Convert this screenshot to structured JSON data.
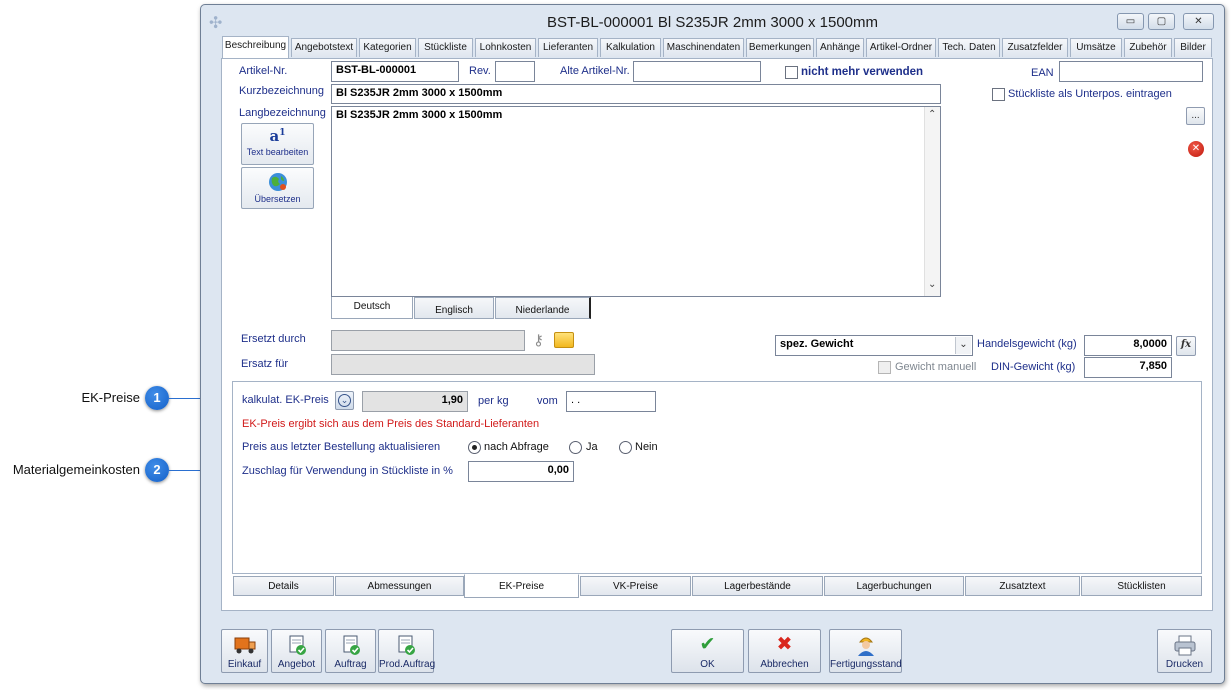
{
  "annotations": [
    {
      "label": "EK-Preise",
      "badge": "1"
    },
    {
      "label": "Materialgemeinkosten",
      "badge": "2"
    }
  ],
  "window": {
    "title": "BST-BL-000001 Bl S235JR 2mm 3000 x 1500mm",
    "controls": {
      "minimize": "▭",
      "maximize": "▢",
      "close": "✕"
    }
  },
  "tabs": [
    "Beschreibung",
    "Angebotstext",
    "Kategorien",
    "Stückliste",
    "Lohnkosten",
    "Lieferanten",
    "Kalkulation",
    "Maschinendaten",
    "Bemerkungen",
    "Anhänge",
    "Artikel-Ordner",
    "Tech. Daten",
    "Zusatzfelder",
    "Umsätze",
    "Zubehör",
    "Bilder"
  ],
  "form": {
    "artikel_nr_label": "Artikel-Nr.",
    "artikel_nr_value": "BST-BL-000001",
    "rev_label": "Rev.",
    "rev_value": "",
    "alte_artikel_label": "Alte Artikel-Nr.",
    "alte_artikel_value": "",
    "nicht_mehr_label": "nicht mehr verwenden",
    "ean_label": "EAN",
    "ean_value": "",
    "kurz_label": "Kurzbezeichnung",
    "kurz_value": "Bl S235JR 2mm 3000 x 1500mm",
    "stueckliste_label": "Stückliste als Unterpos. eintragen",
    "lang_label": "Langbezeichnung",
    "lang_value": "Bl S235JR 2mm 3000 x 1500mm",
    "text_bearbeiten": "Text bearbeiten",
    "uebersetzen": "Übersetzen",
    "dots_button": "...",
    "lang_tabs": [
      "Deutsch",
      "Englisch",
      "Niederlande"
    ],
    "ersetzt_label": "Ersetzt durch",
    "ersatz_label": "Ersatz für",
    "spez_gewicht": "spez. Gewicht",
    "gewicht_manuell": "Gewicht manuell",
    "handelsgewicht_label": "Handelsgewicht (kg)",
    "handelsgewicht_value": "8,0000",
    "fx": "fx",
    "din_label": "DIN-Gewicht (kg)",
    "din_value": "7,850"
  },
  "ek": {
    "kalk_label": "kalkulat. EK-Preis",
    "kalk_value": "1,90",
    "per_label": "per kg",
    "vom_label": "vom",
    "vom_value": ". .",
    "hint": "EK-Preis ergibt sich aus dem Preis des Standard-Lieferanten",
    "preis_label": "Preis aus letzter Bestellung aktualisieren",
    "radio_options": [
      "nach Abfrage",
      "Ja",
      "Nein"
    ],
    "zuschlag_label": "Zuschlag für Verwendung in Stückliste in %",
    "zuschlag_value": "0,00"
  },
  "subtabs": [
    "Details",
    "Abmessungen",
    "EK-Preise",
    "VK-Preise",
    "Lagerbestände",
    "Lagerbuchungen",
    "Zusatztext",
    "Stücklisten"
  ],
  "footer": {
    "einkauf": "Einkauf",
    "angebot": "Angebot",
    "auftrag": "Auftrag",
    "prodauftrag": "Prod.Auftrag",
    "ok": "OK",
    "abbrechen": "Abbrechen",
    "fertigungsstand": "Fertigungsstand",
    "drucken": "Drucken"
  },
  "colors": {
    "label_blue": "#1e2f8a",
    "hint_red": "#d11a1a",
    "accent": "#2a6fd0"
  }
}
